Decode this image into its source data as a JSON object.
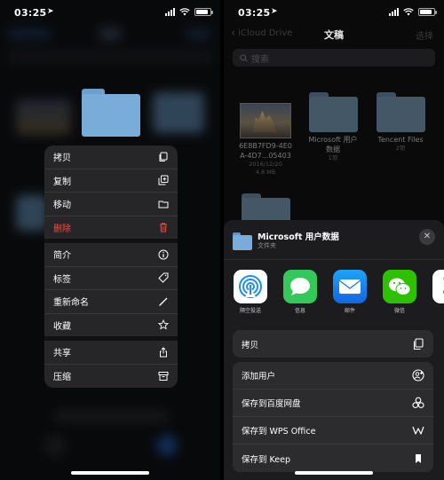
{
  "left_screen": {
    "status": {
      "time": "03:25"
    },
    "context_menu": [
      {
        "label": "拷贝",
        "icon": "copy-icon"
      },
      {
        "label": "复制",
        "icon": "duplicate-icon"
      },
      {
        "label": "移动",
        "icon": "folder-icon"
      },
      {
        "label": "删除",
        "icon": "trash-icon",
        "destructive": true
      },
      {
        "label": "简介",
        "icon": "info-icon"
      },
      {
        "label": "标签",
        "icon": "tag-icon"
      },
      {
        "label": "重新命名",
        "icon": "pencil-icon"
      },
      {
        "label": "收藏",
        "icon": "star-icon"
      },
      {
        "label": "共享",
        "icon": "share-icon"
      },
      {
        "label": "压缩",
        "icon": "archive-icon"
      }
    ]
  },
  "right_screen": {
    "status": {
      "time": "03:25"
    },
    "nav": {
      "back_label": "iCloud Drive",
      "title": "文稿",
      "select_label": "选择"
    },
    "search": {
      "placeholder": "搜索"
    },
    "files": [
      {
        "name_line1": "6E8B7FD9-4E0",
        "name_line2": "A-4D7...05403",
        "meta1": "2016/12/20",
        "meta2": "4.8 MB",
        "kind": "image"
      },
      {
        "name_line1": "Microsoft 用户",
        "name_line2": "数据",
        "meta1": "1项",
        "meta2": "",
        "kind": "folder"
      },
      {
        "name_line1": "Tencent Files",
        "name_line2": "",
        "meta1": "2项",
        "meta2": "",
        "kind": "folder"
      }
    ],
    "share_sheet": {
      "title": "Microsoft 用户数据",
      "subtitle": "文件夹",
      "close_icon": "close-icon",
      "apps": [
        {
          "label": "隔空投送",
          "icon": "airdrop-icon",
          "color": "#ffffff"
        },
        {
          "label": "信息",
          "icon": "messages-icon",
          "color": "#34c759"
        },
        {
          "label": "邮件",
          "icon": "mail-icon",
          "color": "#1e88f0"
        },
        {
          "label": "微信",
          "icon": "wechat-icon",
          "color": "#2dc100"
        },
        {
          "label": "",
          "icon": "app-icon",
          "color": "#ffffff"
        }
      ],
      "actions_top": [
        {
          "label": "拷贝",
          "icon": "copy-icon"
        }
      ],
      "actions": [
        {
          "label": "添加用户",
          "icon": "add-person-icon"
        },
        {
          "label": "保存到百度网盘",
          "icon": "baidu-netdisk-icon"
        },
        {
          "label": "保存到 WPS Office",
          "icon": "wps-icon"
        },
        {
          "label": "保存到 Keep",
          "icon": "bookmark-icon"
        }
      ]
    }
  },
  "colors": {
    "destructive": "#ff453a",
    "folder": "#79acd9",
    "sheet_bg": "#1c1c1e",
    "row_bg": "#2c2c2e"
  }
}
